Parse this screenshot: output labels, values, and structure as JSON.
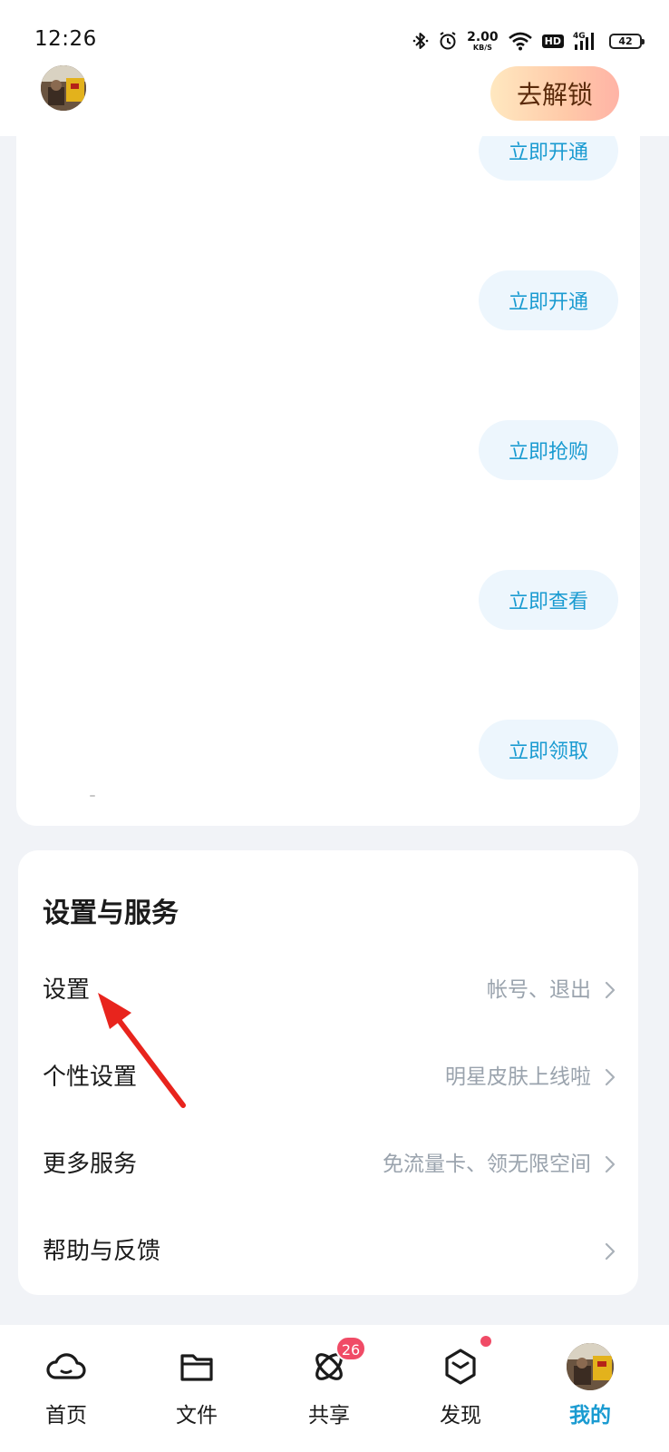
{
  "status_bar": {
    "time": "12:26",
    "speed_value": "2.00",
    "speed_unit": "KB/S",
    "hd": "HD",
    "network": "4G",
    "battery": "42"
  },
  "header": {
    "unlock_label": "去解锁"
  },
  "promo": {
    "buttons": [
      "立即开通",
      "立即开通",
      "立即抢购",
      "立即查看",
      "立即领取"
    ]
  },
  "settings": {
    "title": "设置与服务",
    "rows": [
      {
        "label": "设置",
        "hint": "帐号、退出"
      },
      {
        "label": "个性设置",
        "hint": "明星皮肤上线啦"
      },
      {
        "label": "更多服务",
        "hint": "免流量卡、领无限空间"
      },
      {
        "label": "帮助与反馈",
        "hint": ""
      }
    ]
  },
  "bottom_nav": {
    "items": [
      {
        "label": "首页",
        "icon": "cloud-icon"
      },
      {
        "label": "文件",
        "icon": "folder-icon"
      },
      {
        "label": "共享",
        "icon": "atom-icon",
        "badge": "26"
      },
      {
        "label": "发现",
        "icon": "cube-icon"
      },
      {
        "label": "我的",
        "icon": "avatar"
      }
    ]
  },
  "colors": {
    "accent": "#1a9bd1",
    "badge": "#f04b66",
    "annotation_arrow": "#e8241d"
  }
}
